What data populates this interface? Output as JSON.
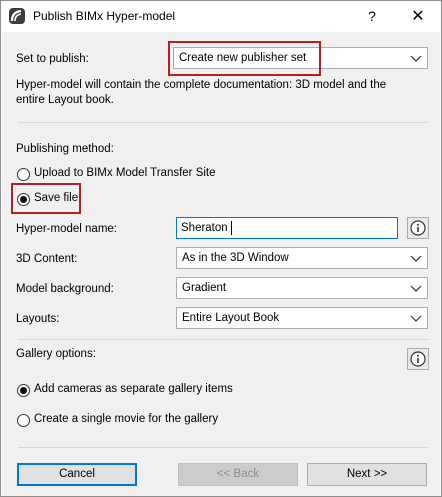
{
  "window": {
    "title": "Publish BIMx Hyper-model",
    "help_label": "?",
    "close_label": "✕"
  },
  "publish": {
    "set_label": "Set to publish:",
    "set_value": "Create new publisher set",
    "description": "Hyper-model will contain the complete documentation: 3D model and the entire Layout book."
  },
  "method": {
    "heading": "Publishing method:",
    "options": [
      {
        "label": "Upload to BIMx Model Transfer Site",
        "selected": false
      },
      {
        "label": "Save file",
        "selected": true
      }
    ]
  },
  "fields": {
    "name_label": "Hyper-model name:",
    "name_value": "Sheraton",
    "content_label": "3D Content:",
    "content_value": "As in the 3D Window",
    "background_label": "Model background:",
    "background_value": "Gradient",
    "layouts_label": "Layouts:",
    "layouts_value": "Entire Layout Book"
  },
  "gallery": {
    "heading": "Gallery options:",
    "options": [
      {
        "label": "Add cameras as separate gallery items",
        "selected": true
      },
      {
        "label": "Create a single movie for the gallery",
        "selected": false
      }
    ]
  },
  "buttons": {
    "cancel": "Cancel",
    "back": "<< Back",
    "next": "Next >>"
  },
  "colors": {
    "highlight": "#b22222",
    "focus": "#0078d7"
  }
}
